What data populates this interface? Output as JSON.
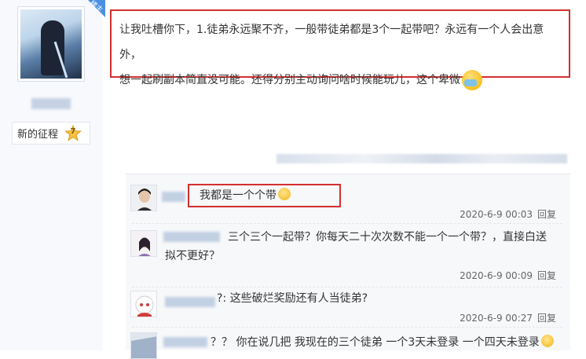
{
  "author": {
    "badge": "楼主",
    "level_name": "新的征程",
    "level_number": "7",
    "avatar_icon": "anime-warrior-avatar"
  },
  "post": {
    "text_line1": "让我吐槽你下，1.徒弟永远聚不齐，一般带徒弟都是3个一起带吧？永远有一个人会出意外，",
    "text_line2": "想一起刷副本简直没可能。还得分别主动询问啥时候能玩儿，这个卑微",
    "emoji": "sick-face-emoji"
  },
  "replies": [
    {
      "text": "我都是一个个带",
      "emoji": "smile-emoji",
      "date": "2020-6-9 00:03",
      "reply_label": "回复"
    },
    {
      "text_line1": "三个三个一起带？你每天二十次次数不能一个一个带？，直接白送",
      "text_line2": "拟不更好？",
      "date": "2020-6-9 00:09",
      "reply_label": "回复"
    },
    {
      "text": "?: 这些破烂奖励还有人当徒弟?",
      "date": "2020-6-9 00:27",
      "reply_label": "回复"
    },
    {
      "text": "？？ 你在说几把 我现在的三个徒弟 一个3天未登录 一个四天未登录",
      "emoji": "grin-emoji"
    }
  ],
  "colors": {
    "highlight_red": "#d32f2f",
    "sidebar_bg": "#f7f9fc",
    "reply_bg": "#f7f8fa"
  }
}
